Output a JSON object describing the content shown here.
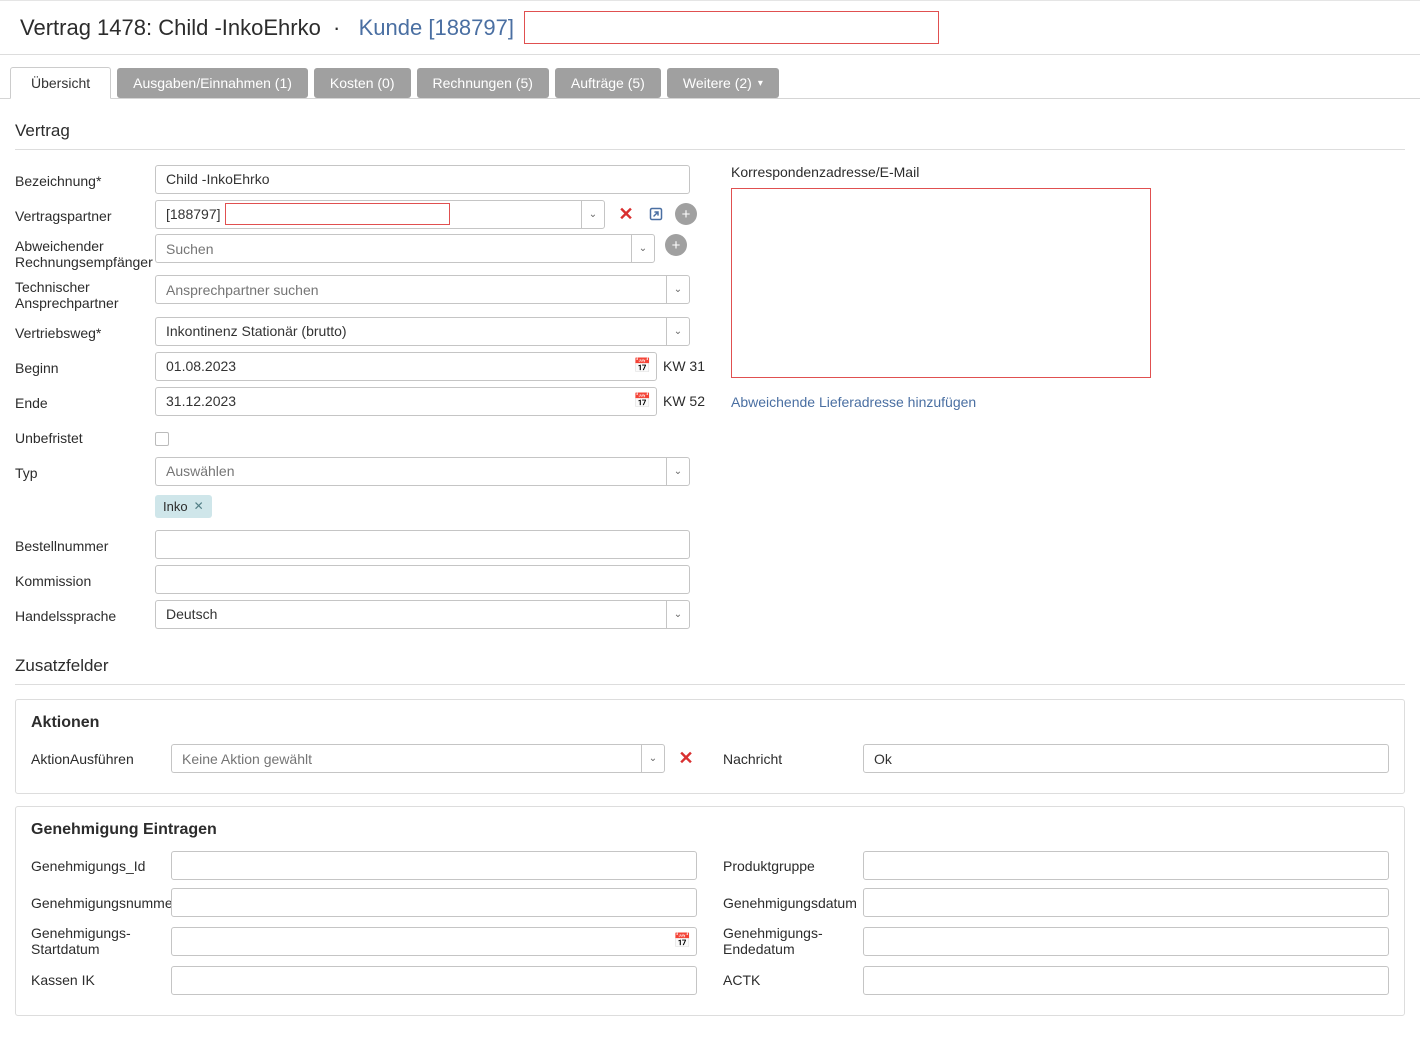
{
  "header": {
    "title_prefix": "Vertrag 1478: Child -InkoEhrko  ·  ",
    "customer_link": "Kunde [188797]"
  },
  "tabs": [
    {
      "label": "Übersicht",
      "active": true
    },
    {
      "label": "Ausgaben/Einnahmen (1)"
    },
    {
      "label": "Kosten (0)"
    },
    {
      "label": "Rechnungen (5)"
    },
    {
      "label": "Aufträge (5)"
    },
    {
      "label": "Weitere (2)",
      "dropdown": true
    }
  ],
  "section_contract": "Vertrag",
  "fields": {
    "bezeichnung": {
      "label": "Bezeichnung*",
      "value": "Child -InkoEhrko"
    },
    "vertragspartner": {
      "label": "Vertragspartner",
      "id_text": "[188797]"
    },
    "rechnungsempfaenger": {
      "label": "Abweichender Rechnungsempfänger",
      "placeholder": "Suchen"
    },
    "ansprechpartner": {
      "label": "Technischer Ansprechpartner",
      "placeholder": "Ansprechpartner suchen"
    },
    "vertriebsweg": {
      "label": "Vertriebsweg*",
      "value": "Inkontinenz Stationär (brutto)"
    },
    "beginn": {
      "label": "Beginn",
      "value": "01.08.2023",
      "kw": "KW 31"
    },
    "ende": {
      "label": "Ende",
      "value": "31.12.2023",
      "kw": "KW 52"
    },
    "unbefristet": {
      "label": "Unbefristet"
    },
    "typ": {
      "label": "Typ",
      "placeholder": "Auswählen"
    },
    "tag_inko": "Inko",
    "bestellnummer": {
      "label": "Bestellnummer"
    },
    "kommission": {
      "label": "Kommission"
    },
    "handelssprache": {
      "label": "Handelssprache",
      "value": "Deutsch"
    }
  },
  "right": {
    "heading": "Korrespondenzadresse/E-Mail",
    "add_link": "Abweichende Lieferadresse hinzufügen"
  },
  "section_extra": "Zusatzfelder",
  "aktionen": {
    "title": "Aktionen",
    "exec_label": "AktionAusführen",
    "exec_placeholder": "Keine Aktion gewählt",
    "msg_label": "Nachricht",
    "msg_value": "Ok"
  },
  "genehmigung": {
    "title": "Genehmigung Eintragen",
    "gen_id": "Genehmigungs_Id",
    "produktgruppe": "Produktgruppe",
    "gennummer": "Genehmigungsnummer",
    "gendatum": "Genehmigungsdatum",
    "genstart": "Genehmigungs-Startdatum",
    "genende": "Genehmigungs-Endedatum",
    "kassenik": "Kassen IK",
    "actk": "ACTK"
  }
}
